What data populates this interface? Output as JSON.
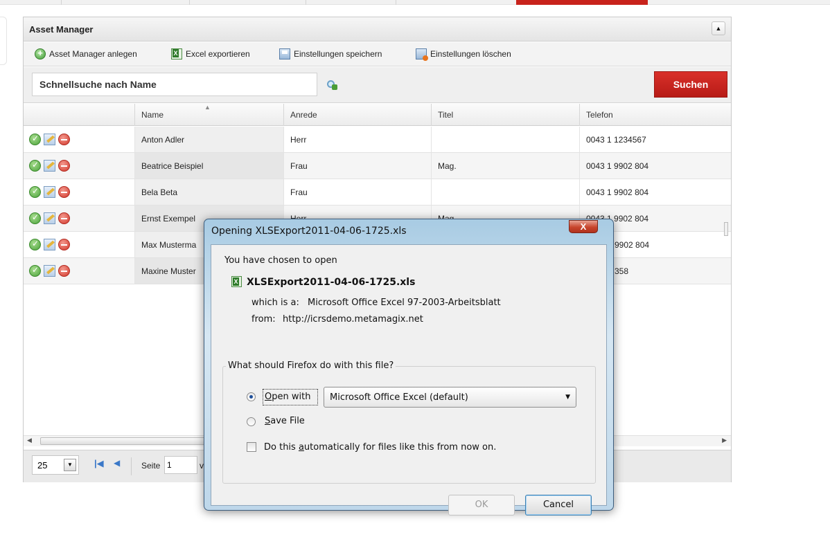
{
  "panel": {
    "title": "Asset Manager",
    "collapse_glyph": "▲"
  },
  "toolbar": {
    "create_label": "Asset Manager anlegen",
    "export_label": "Excel exportieren",
    "save_settings_label": "Einstellungen speichern",
    "delete_settings_label": "Einstellungen löschen"
  },
  "search": {
    "value": "Schnellsuche nach Name",
    "button_label": "Suchen"
  },
  "grid": {
    "columns": [
      "Name",
      "Anrede",
      "Titel",
      "Telefon"
    ],
    "sort_glyph": "▲",
    "rows": [
      {
        "name": "Anton Adler",
        "anrede": "Herr",
        "titel": "",
        "telefon": "0043 1 1234567"
      },
      {
        "name": "Beatrice Beispiel",
        "anrede": "Frau",
        "titel": "Mag.",
        "telefon": "0043 1 9902 804"
      },
      {
        "name": "Bela Beta",
        "anrede": "Frau",
        "titel": "",
        "telefon": "0043 1 9902 804"
      },
      {
        "name": "Ernst Exempel",
        "anrede": "Herr",
        "titel": "Mag.",
        "telefon": "0043 1 9902 804"
      },
      {
        "name": "Max Musterma",
        "anrede": "",
        "titel": "",
        "telefon": "9902 804"
      },
      {
        "name": "Maxine Muster",
        "anrede": "",
        "titel": "",
        "telefon": "358"
      }
    ]
  },
  "pager": {
    "page_size": "25",
    "page_label": "Seite",
    "page_value": "1",
    "trailing": "v"
  },
  "dialog": {
    "title": "Opening XLSExport2011-04-06-1725.xls",
    "close_glyph": "X",
    "intro": "You have chosen to open",
    "filename": "XLSExport2011-04-06-1725.xls",
    "which_is_label": "which is a:",
    "which_is_value": "Microsoft Office Excel 97-2003-Arbeitsblatt",
    "from_label": "from:",
    "from_value": "http://icrsdemo.metamagix.net",
    "question": "What should Firefox do with this file?",
    "open_with_key": "O",
    "open_with_rest": "pen with",
    "app_value": "Microsoft Office Excel (default)",
    "save_key": "S",
    "save_rest": "ave File",
    "auto_before": "Do this ",
    "auto_key": "a",
    "auto_after": "utomatically for files like this from now on.",
    "ok_label": "OK",
    "cancel_label": "Cancel"
  }
}
